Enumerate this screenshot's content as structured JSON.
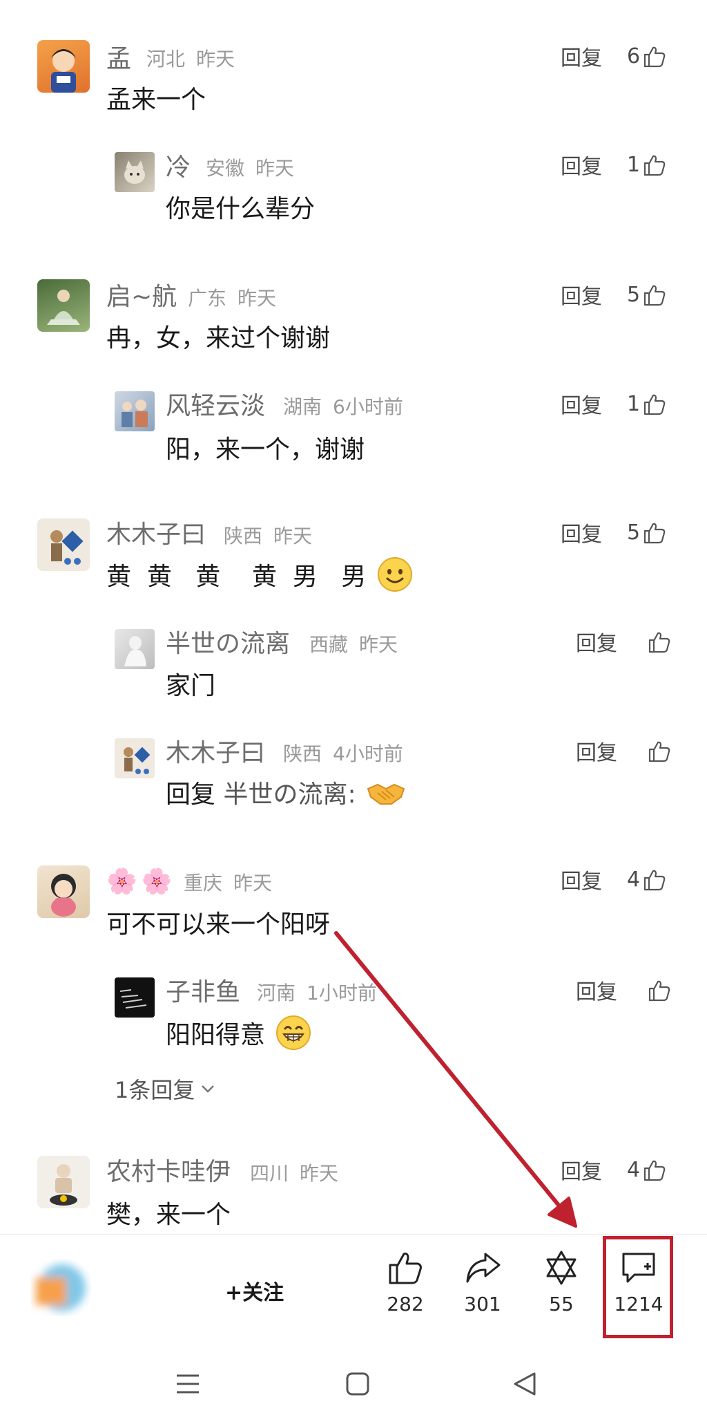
{
  "colors": {
    "accent_red": "#c0212e",
    "name_grey": "#6d6d6d",
    "meta_grey": "#9a9a9a"
  },
  "comments": [
    {
      "name": "孟",
      "location": "河北",
      "time": "昨天",
      "text": "孟来一个",
      "reply_label": "回复",
      "likes": "6"
    },
    {
      "name": "冷",
      "location": "安徽",
      "time": "昨天",
      "text": "你是什么辈分",
      "reply_label": "回复",
      "likes": "1"
    },
    {
      "name": "启~航",
      "location": "广东",
      "time": "昨天",
      "text": "冉，女，来过个谢谢",
      "reply_label": "回复",
      "likes": "5"
    },
    {
      "name": "风轻云淡",
      "location": "湖南",
      "time": "6小时前",
      "text": "阳，来一个，谢谢",
      "reply_label": "回复",
      "likes": "1"
    },
    {
      "name": "木木子曰",
      "location": "陕西",
      "time": "昨天",
      "text": "黄  黄   黄    黄  男   男",
      "reply_label": "回复",
      "likes": "5"
    },
    {
      "name": "半世の流离",
      "location": "西藏",
      "time": "昨天",
      "text": "家门",
      "reply_label": "回复",
      "likes": ""
    },
    {
      "name": "木木子曰",
      "location": "陕西",
      "time": "4小时前",
      "text_prefix": "回复",
      "text": "半世の流离:",
      "reply_label": "回复",
      "likes": ""
    },
    {
      "name": "🌸🌸",
      "location": "重庆",
      "time": "昨天",
      "text": "可不可以来一个阳呀",
      "reply_label": "回复",
      "likes": "4"
    },
    {
      "name": "子非鱼",
      "location": "河南",
      "time": "1小时前",
      "text": "阳阳得意",
      "reply_label": "回复",
      "likes": ""
    },
    {
      "name": "农村卡哇伊",
      "location": "四川",
      "time": "昨天",
      "text": "樊，来一个",
      "reply_label": "回复",
      "likes": "4"
    }
  ],
  "more_replies": "1条回复",
  "bottom_bar": {
    "follow_label": "+关注",
    "like_count": "282",
    "share_count": "301",
    "collect_count": "55",
    "comment_count": "1214"
  }
}
